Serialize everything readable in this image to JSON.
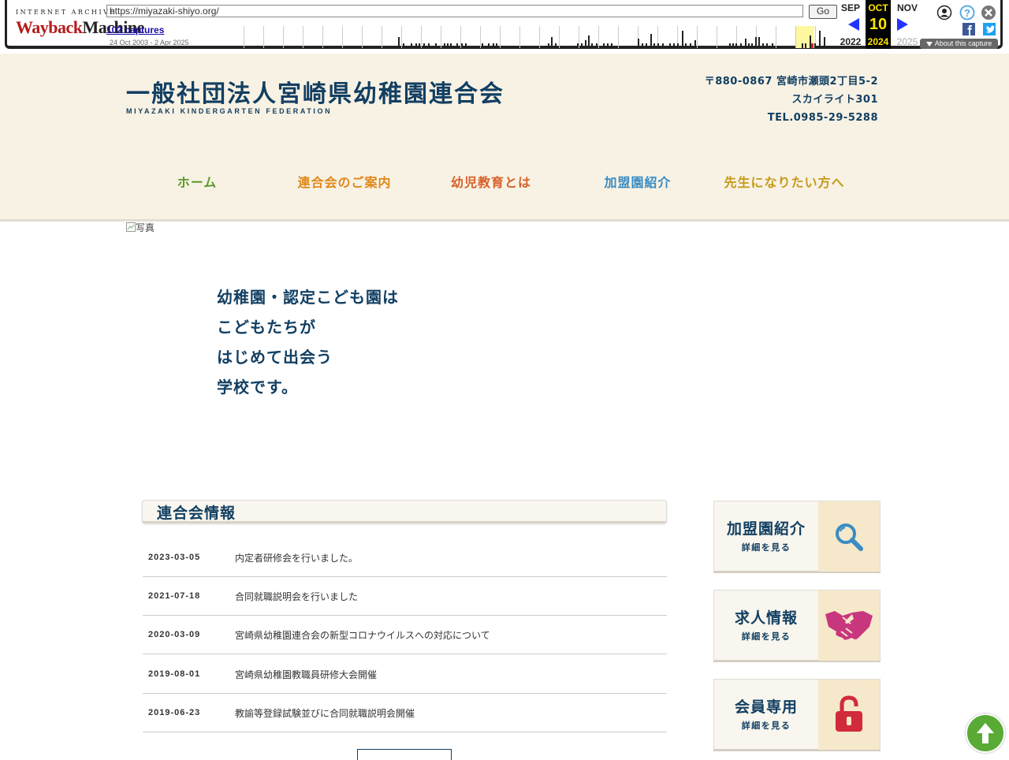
{
  "wayback": {
    "logo_top": "INTERNET ARCHIVE",
    "logo_main_red": "Wayback",
    "logo_main_dark": "Machine",
    "url": "https://miyazaki-shiyo.org/",
    "go_label": "Go",
    "captures": "102 captures",
    "range": "24 Oct 2003 - 2 Apr 2025",
    "months": {
      "prev": "SEP",
      "current": "OCT",
      "next": "NOV"
    },
    "day": "10",
    "years": {
      "prev": "2022",
      "current": "2024",
      "next": "2025"
    },
    "about": "About this capture",
    "colors": {
      "accent": "#ffe600",
      "current_bg": "#000000",
      "arrow": "#2233ff"
    }
  },
  "site": {
    "title": "一般社団法人宮崎県幼稚園連合会",
    "subtitle": "MIYAZAKI KINDERGARTEN FEDERATION",
    "address": [
      "〒880-0867 宮崎市瀬頭2丁目5-2",
      "スカイライト301",
      "TEL.0985-29-5288"
    ],
    "nav": [
      {
        "label": "ホーム",
        "color": "#5a9a2a"
      },
      {
        "label": "連合会のご案内",
        "color": "#e0871a"
      },
      {
        "label": "幼児教育とは",
        "color": "#d9602a"
      },
      {
        "label": "加盟園紹介",
        "color": "#3a8cc2"
      },
      {
        "label": "先生になりたい方へ",
        "color": "#c49a18"
      }
    ],
    "colors": {
      "brand": "#123f62",
      "header_bg": "#f8f2e4"
    }
  },
  "hero": {
    "image_alt": "写真",
    "lines": [
      "幼稚園・認定こども園は",
      "こどもたちが",
      "はじめて出会う",
      "学校です。"
    ]
  },
  "news": {
    "title": "連合会情報",
    "items": [
      {
        "date": "2023-03-05",
        "text": "内定者研修会を行いました。"
      },
      {
        "date": "2021-07-18",
        "text": "合同就職説明会を行いました"
      },
      {
        "date": "2020-03-09",
        "text": "宮崎県幼稚園連合会の新型コロナウイルスへの対応について"
      },
      {
        "date": "2019-08-01",
        "text": "宮崎県幼稚園教職員研修大会開催"
      },
      {
        "date": "2019-06-23",
        "text": "教諭等登録試験並びに合同就職説明会開催"
      }
    ]
  },
  "cards": [
    {
      "title": "加盟園紹介",
      "sub": "詳細を見る",
      "icon": "search-icon"
    },
    {
      "title": "求人情報",
      "sub": "詳細を見る",
      "icon": "handshake-icon"
    },
    {
      "title": "会員専用",
      "sub": "詳細を見る",
      "icon": "lock-icon"
    }
  ]
}
